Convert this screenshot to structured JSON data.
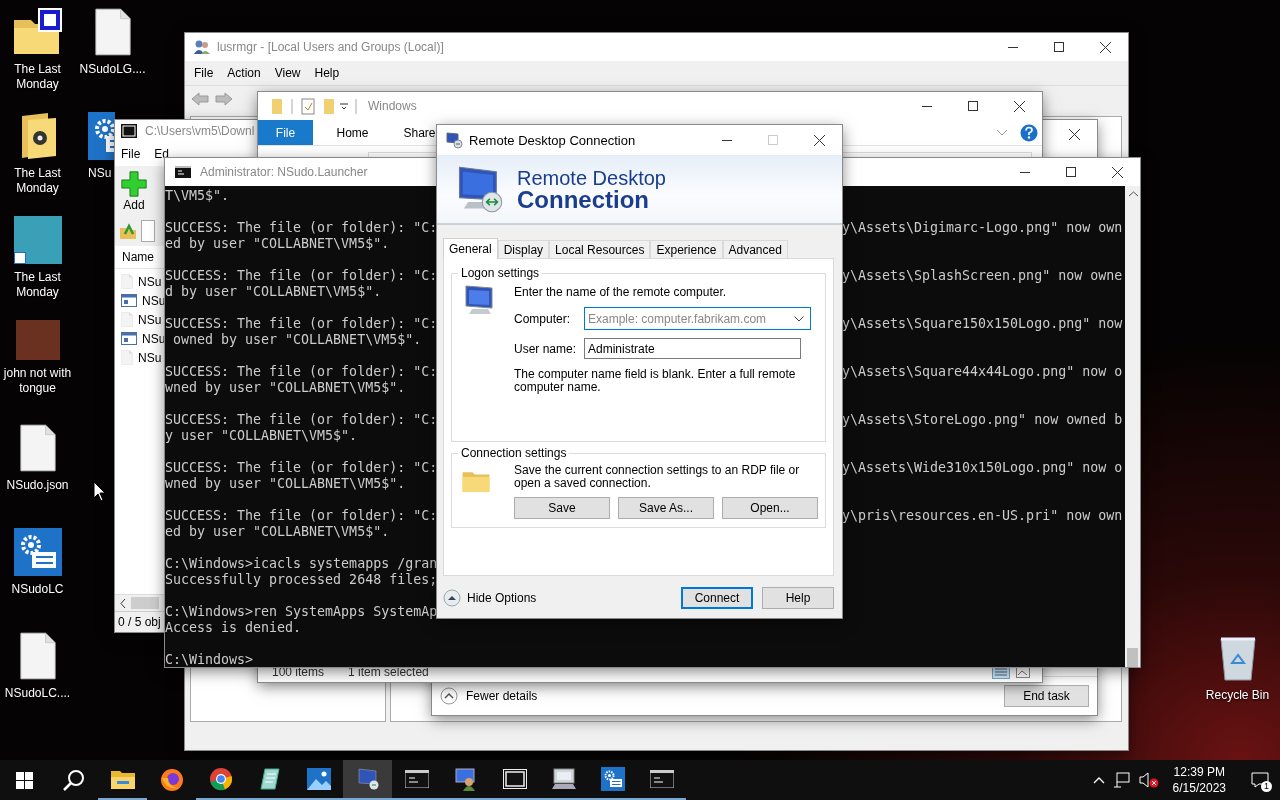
{
  "desktop": {
    "columns": [
      [
        {
          "label": "The Last Monday",
          "kind": "zip-folder"
        },
        {
          "label": "The Last Monday",
          "kind": "media-folder"
        },
        {
          "label": "The Last Monday",
          "kind": "shortcut-picture"
        },
        {
          "label": "john not with tongue",
          "kind": "picture"
        },
        {
          "label": "NSudo.json",
          "kind": "file"
        },
        {
          "label": "NSudoLC",
          "kind": "settings-app"
        },
        {
          "label": "NSudoLC....",
          "kind": "file"
        }
      ],
      [
        {
          "label": "NSudoLG....",
          "kind": "file"
        },
        {
          "label": "NSu",
          "kind": "settings-app",
          "cut_off": true
        }
      ]
    ],
    "recycle_bin": {
      "label": "Recycle Bin"
    }
  },
  "lusrmgr": {
    "title": "lusrmgr - [Local Users and Groups (Local)]",
    "menu": [
      "File",
      "Action",
      "View",
      "Help"
    ]
  },
  "task_manager": {
    "fewer_details": "Fewer details",
    "end_task": "End task"
  },
  "sevenzip": {
    "title": "C:\\Users\\vm5\\Downl",
    "menu": [
      "File",
      "Ed"
    ],
    "add": "Add",
    "column": "Name",
    "rows": [
      {
        "name": "NSu",
        "kind": "file"
      },
      {
        "name": "NSu",
        "kind": "app"
      },
      {
        "name": "NSu",
        "kind": "file"
      },
      {
        "name": "NSu",
        "kind": "app"
      },
      {
        "name": "NSu",
        "kind": "file"
      }
    ],
    "status": "0 / 5 obj"
  },
  "explorer": {
    "title": "Windows",
    "tabs": [
      {
        "label": "File",
        "selected": true
      },
      {
        "label": "Home",
        "selected": false
      },
      {
        "label": "Share",
        "selected": false
      }
    ],
    "status": [
      "100 items",
      "1 item selected"
    ]
  },
  "console": {
    "title": "Administrator: NSudo.Launcher",
    "blocks": [
      [
        {
          "left": "T\\VM5$\"."
        }
      ],
      [
        {
          "left": "SUCCESS: The file (or folder): \"C:",
          "right": "y\\Assets\\Digimarc-Logo.png\" now own"
        },
        {
          "left": "ed by user \"COLLABNET\\VM5$\"."
        }
      ],
      [
        {
          "left": "SUCCESS: The file (or folder): \"C:",
          "right": "y\\Assets\\SplashScreen.png\" now owne"
        },
        {
          "left": "d by user \"COLLABNET\\VM5$\"."
        }
      ],
      [
        {
          "left": "SUCCESS: The file (or folder): \"C:",
          "right": "y\\Assets\\Square150x150Logo.png\" now"
        },
        {
          "left": " owned by user \"COLLABNET\\VM5$\"."
        }
      ],
      [
        {
          "left": "SUCCESS: The file (or folder): \"C:",
          "right": "y\\Assets\\Square44x44Logo.png\" now o"
        },
        {
          "left": "wned by user \"COLLABNET\\VM5$\"."
        }
      ],
      [
        {
          "left": "SUCCESS: The file (or folder): \"C:",
          "right": "y\\Assets\\StoreLogo.png\" now owned b"
        },
        {
          "left": "y user \"COLLABNET\\VM5$\"."
        }
      ],
      [
        {
          "left": "SUCCESS: The file (or folder): \"C:",
          "right": "y\\Assets\\Wide310x150Logo.png\" now o"
        },
        {
          "left": "wned by user \"COLLABNET\\VM5$\"."
        }
      ],
      [
        {
          "left": "SUCCESS: The file (or folder): \"C:",
          "right": "y\\pris\\resources.en-US.pri\" now own"
        },
        {
          "left": "ed by user \"COLLABNET\\VM5$\"."
        }
      ],
      [
        {
          "left": "C:\\Windows>icacls systemapps /gran"
        },
        {
          "left": "Successfully processed 2648 files;"
        }
      ],
      [
        {
          "left": "C:\\Windows>ren SystemApps SystemAp"
        },
        {
          "left": "Access is denied."
        }
      ],
      [
        {
          "left": "C:\\Windows>"
        }
      ]
    ]
  },
  "rdc": {
    "title": "Remote Desktop Connection",
    "maximize_disabled": true,
    "banner": [
      "Remote Desktop",
      "Connection"
    ],
    "tabs": [
      {
        "label": "General",
        "selected": true
      },
      {
        "label": "Display",
        "selected": false
      },
      {
        "label": "Local Resources",
        "selected": false
      },
      {
        "label": "Experience",
        "selected": false
      },
      {
        "label": "Advanced",
        "selected": false
      }
    ],
    "logon": {
      "legend": "Logon settings",
      "prompt": "Enter the name of the remote computer.",
      "computer_label": "Computer:",
      "computer_placeholder": "Example: computer.fabrikam.com",
      "username_label": "User name:",
      "username": "Administrate",
      "message": "The computer name field is blank. Enter a full remote computer name."
    },
    "connection": {
      "legend": "Connection settings",
      "text": "Save the current connection settings to an RDP file or open a saved connection.",
      "buttons": [
        "Save",
        "Save As...",
        "Open..."
      ]
    },
    "hide_options": "Hide Options",
    "buttons": [
      {
        "label": "Connect",
        "default": true
      },
      {
        "label": "Help",
        "default": false
      }
    ]
  },
  "taskbar": {
    "items": [
      {
        "kind": "start",
        "running": false,
        "selected": false
      },
      {
        "kind": "search",
        "running": false,
        "selected": false
      },
      {
        "kind": "explorer",
        "running": true,
        "selected": false
      },
      {
        "kind": "firefox",
        "running": false,
        "selected": false
      },
      {
        "kind": "chrome",
        "running": true,
        "selected": false
      },
      {
        "kind": "notepad",
        "running": true,
        "selected": false
      },
      {
        "kind": "photos",
        "running": true,
        "selected": false
      },
      {
        "kind": "remote-desktop",
        "running": true,
        "selected": true
      },
      {
        "kind": "console",
        "running": true,
        "selected": false
      },
      {
        "kind": "users",
        "running": true,
        "selected": false
      },
      {
        "kind": "archiver",
        "running": true,
        "selected": false
      },
      {
        "kind": "computer",
        "running": true,
        "selected": false
      },
      {
        "kind": "settings-app",
        "running": true,
        "selected": false
      },
      {
        "kind": "console",
        "running": true,
        "selected": false
      }
    ],
    "time": "12:39 PM",
    "date": "6/15/2023",
    "notifications": "1"
  }
}
